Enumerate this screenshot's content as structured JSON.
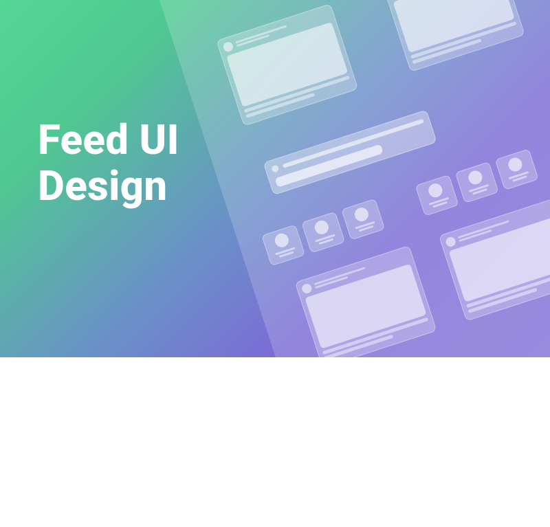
{
  "title": {
    "line1": "Feed UI",
    "line2": "Design"
  }
}
